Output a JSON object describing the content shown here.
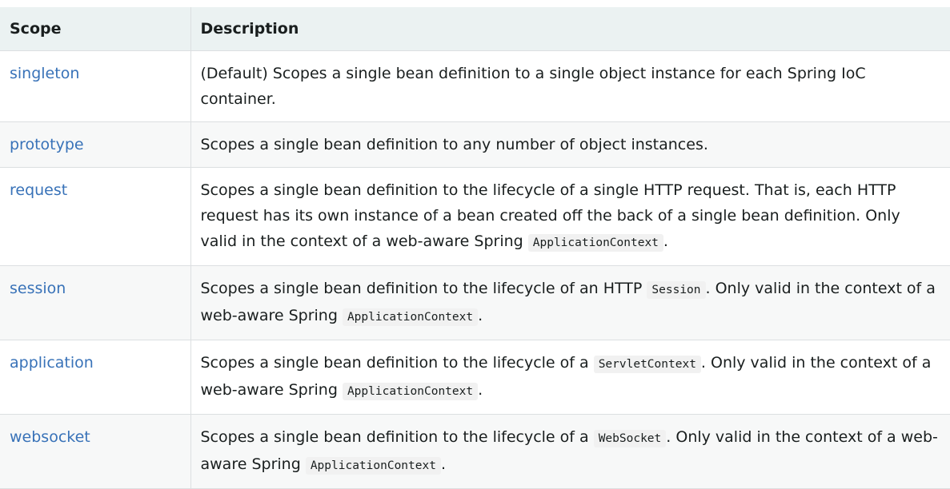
{
  "table": {
    "headers": [
      "Scope",
      "Description"
    ],
    "rows": [
      {
        "scope": "singleton",
        "desc": [
          "(Default) Scopes a single bean definition to a single object instance for each Spring IoC container."
        ],
        "code": []
      },
      {
        "scope": "prototype",
        "desc": [
          "Scopes a single bean definition to any number of object instances."
        ],
        "code": []
      },
      {
        "scope": "request",
        "desc": [
          "Scopes a single bean definition to the lifecycle of a single HTTP request. That is, each HTTP request has its own instance of a bean created off the back of a single bean definition. Only valid in the context of a web-aware Spring ",
          "."
        ],
        "code": [
          "ApplicationContext"
        ]
      },
      {
        "scope": "session",
        "desc": [
          "Scopes a single bean definition to the lifecycle of an HTTP ",
          ". Only valid in the context of a web-aware Spring ",
          "."
        ],
        "code": [
          "Session",
          "ApplicationContext"
        ]
      },
      {
        "scope": "application",
        "desc": [
          "Scopes a single bean definition to the lifecycle of a ",
          ". Only valid in the context of a web-aware Spring ",
          "."
        ],
        "code": [
          "ServletContext",
          "ApplicationContext"
        ]
      },
      {
        "scope": "websocket",
        "desc": [
          "Scopes a single bean definition to the lifecycle of a ",
          ". Only valid in the context of a web-aware Spring ",
          "."
        ],
        "code": [
          "WebSocket",
          "ApplicationContext"
        ]
      }
    ]
  },
  "colors": {
    "link": "#3872b8",
    "header_bg": "#ebf2f2",
    "stripe_bg": "#f7f8f8",
    "border": "#dcdfe1",
    "code_bg": "#f1f1f1"
  }
}
